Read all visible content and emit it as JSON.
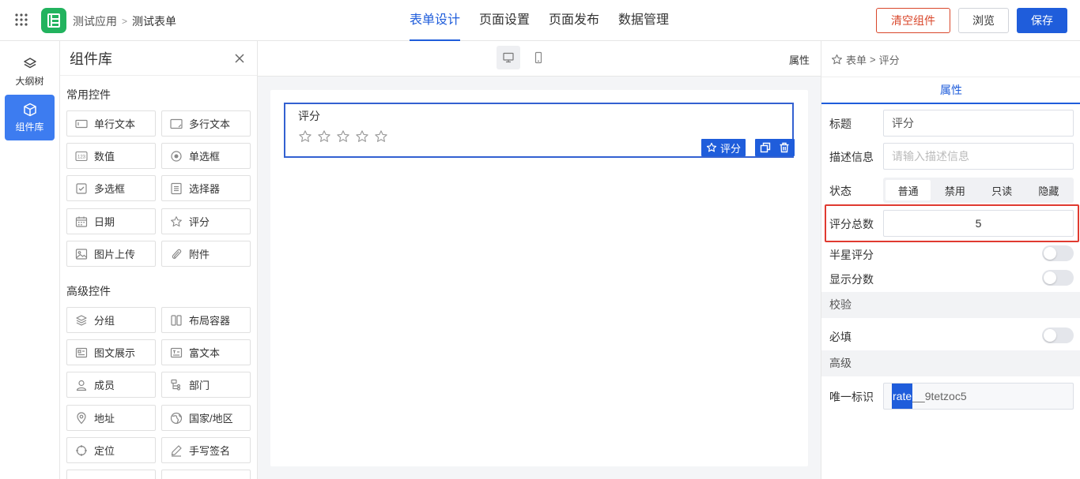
{
  "breadcrumb": {
    "app": "测试应用",
    "sep": ">",
    "form": "测试表单"
  },
  "tabs": [
    "表单设计",
    "页面设置",
    "页面发布",
    "数据管理"
  ],
  "actions": {
    "clear": "清空组件",
    "preview": "浏览",
    "save": "保存"
  },
  "rail": {
    "outline": "大纲树",
    "components": "组件库"
  },
  "library": {
    "title": "组件库",
    "common_title": "常用控件",
    "advanced_title": "高级控件",
    "common": [
      "单行文本",
      "多行文本",
      "数值",
      "单选框",
      "多选框",
      "选择器",
      "日期",
      "评分",
      "图片上传",
      "附件"
    ],
    "advanced": [
      "分组",
      "布局容器",
      "图文展示",
      "富文本",
      "成员",
      "部门",
      "地址",
      "国家/地区",
      "定位",
      "手写签名"
    ]
  },
  "canvas": {
    "attr_link": "属性",
    "field_label": "评分",
    "star_count": 5,
    "tag_label": "评分"
  },
  "props": {
    "breadcrumb_root": "表单",
    "breadcrumb_sep": ">",
    "breadcrumb_leaf": "评分",
    "tab": "属性",
    "title_label": "标题",
    "title_value": "评分",
    "desc_label": "描述信息",
    "desc_placeholder": "请输入描述信息",
    "state_label": "状态",
    "states": [
      "普通",
      "禁用",
      "只读",
      "隐藏"
    ],
    "state_selected": "普通",
    "total_label": "评分总数",
    "total_value": "5",
    "half_label": "半星评分",
    "half_on": false,
    "show_score_label": "显示分数",
    "show_score_on": false,
    "validate_title": "校验",
    "required_label": "必填",
    "required_on": false,
    "advanced_title": "高级",
    "id_label": "唯一标识",
    "id_selected": "rate",
    "id_rest": "__9tetzoc5"
  },
  "colors": {
    "accent": "#1f5ddb",
    "danger": "#d9472b",
    "logo": "#22b35e",
    "highlight": "#e03a30"
  }
}
